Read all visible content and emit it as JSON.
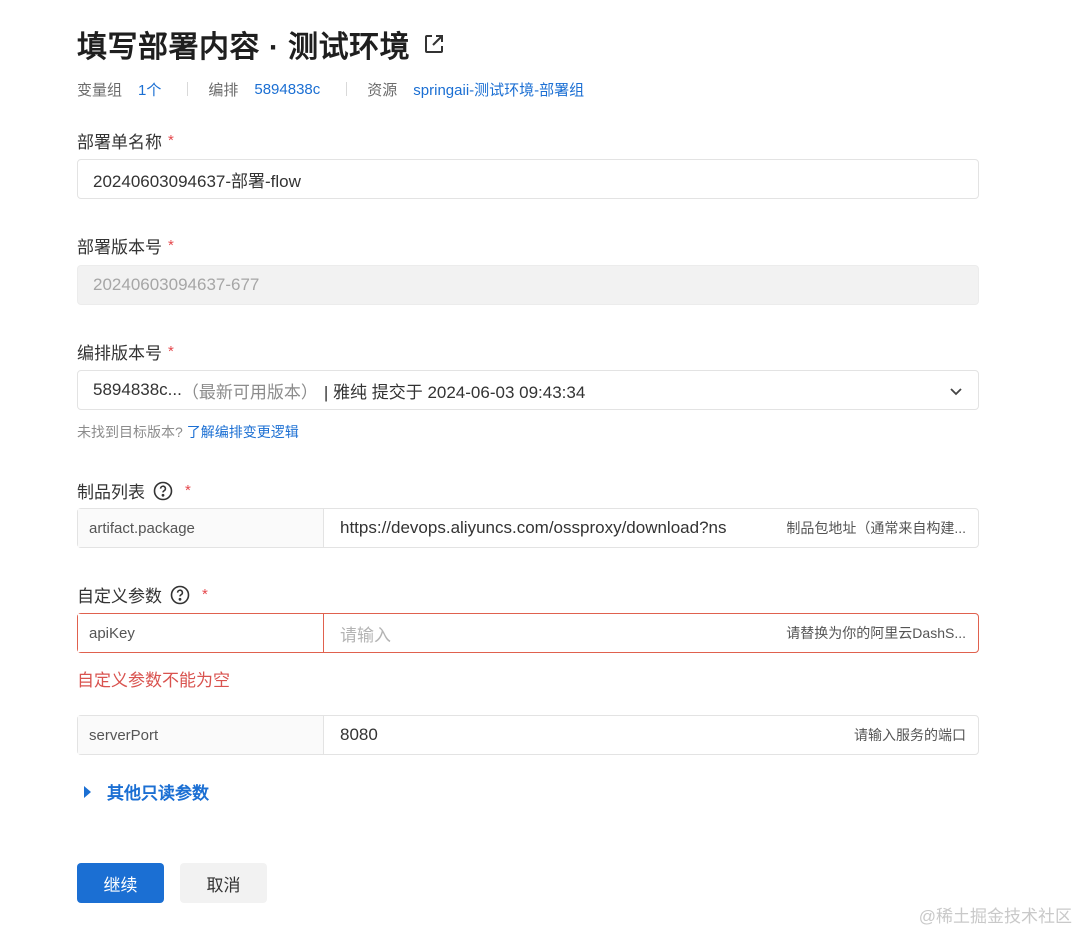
{
  "header": {
    "title": "填写部署内容 · 测试环境",
    "external_icon": "external-link-icon"
  },
  "meta": {
    "var_group_label": "变量组",
    "var_group_value": "1个",
    "orchestration_label": "编排",
    "orchestration_value": "5894838c",
    "resource_label": "资源",
    "resource_value": "springaii-测试环境-部署组"
  },
  "fields": {
    "deploy_name": {
      "label": "部署单名称",
      "required": "*",
      "value": "20240603094637-部署-flow"
    },
    "deploy_version": {
      "label": "部署版本号",
      "required": "*",
      "value": "20240603094637-677"
    },
    "orchestration_version": {
      "label": "编排版本号",
      "required": "*",
      "selected_prefix": "5894838c...",
      "selected_tag": "（最新可用版本）",
      "selected_suffix": "| 雅纯 提交于 2024-06-03 09:43:34",
      "hint": "未找到目标版本?",
      "hint_link": "了解编排变更逻辑"
    },
    "artifacts": {
      "label": "制品列表",
      "required": "*",
      "rows": [
        {
          "key": "artifact.package",
          "value": "https://devops.aliyuncs.com/ossproxy/download?ns",
          "desc": "制品包地址（通常来自构建..."
        }
      ]
    },
    "custom_params": {
      "label": "自定义参数",
      "required": "*",
      "rows": [
        {
          "key": "apiKey",
          "placeholder": "请输入",
          "desc": "请替换为你的阿里云DashS..."
        },
        {
          "key": "serverPort",
          "value": "8080",
          "desc": "请输入服务的端口"
        }
      ],
      "error": "自定义参数不能为空"
    }
  },
  "readonly_params": {
    "label": "其他只读参数"
  },
  "actions": {
    "continue": "继续",
    "cancel": "取消"
  },
  "watermark": "@稀土掘金技术社区",
  "colors": {
    "accent": "#1b6fd3",
    "error": "#e0614e",
    "required": "#e5484d"
  }
}
